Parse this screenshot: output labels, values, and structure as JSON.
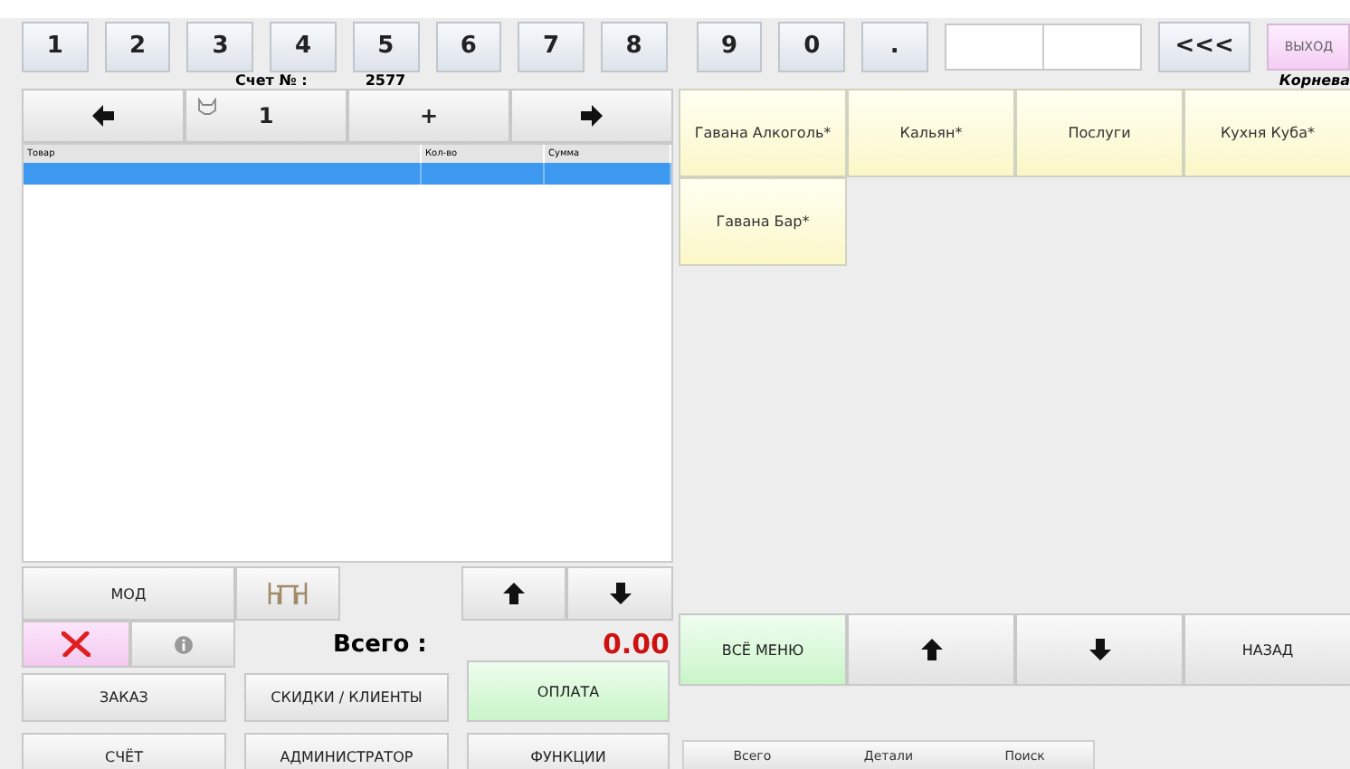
{
  "keypad": {
    "keys": [
      "1",
      "2",
      "3",
      "4",
      "5",
      "6",
      "7",
      "8",
      "9",
      "0",
      "."
    ],
    "backspace": "<<<",
    "exit": "ВЫХОД"
  },
  "user": "Корнева",
  "check": {
    "label": "Счет № :",
    "number": "2577"
  },
  "order_nav": {
    "page": "1",
    "add": "+"
  },
  "order_table": {
    "columns": [
      "Товар",
      "Кол-во",
      "Сумма"
    ],
    "rows": [
      {
        "selected": true
      }
    ]
  },
  "modifier_button": "МОД",
  "total": {
    "label": "Всего :",
    "value": "0.00"
  },
  "buttons": [
    {
      "label": "ЗАКАЗ",
      "kind": "plain"
    },
    {
      "label": "СКИДКИ / КЛИЕНТЫ",
      "kind": "plain"
    },
    {
      "label": "ОПЛАТА",
      "kind": "accent"
    },
    {
      "label": "СЧЁТ",
      "kind": "plain"
    },
    {
      "label": "АДМИНИСТРАТОР",
      "kind": "plain"
    },
    {
      "label": "ФУНКЦИИ",
      "kind": "plain"
    }
  ],
  "categories": [
    "Гавана Алкоголь*",
    "Кальян*",
    "Послуги",
    "Кухня Куба*",
    "Гавана Бар*"
  ],
  "menu_nav": {
    "all": "ВСЁ МЕНЮ",
    "back": "НАЗАД"
  },
  "tabs": [
    {
      "label": "Всего",
      "selected": false
    },
    {
      "label": "Детали",
      "selected": false
    },
    {
      "label": "Поиск",
      "selected": false
    }
  ]
}
